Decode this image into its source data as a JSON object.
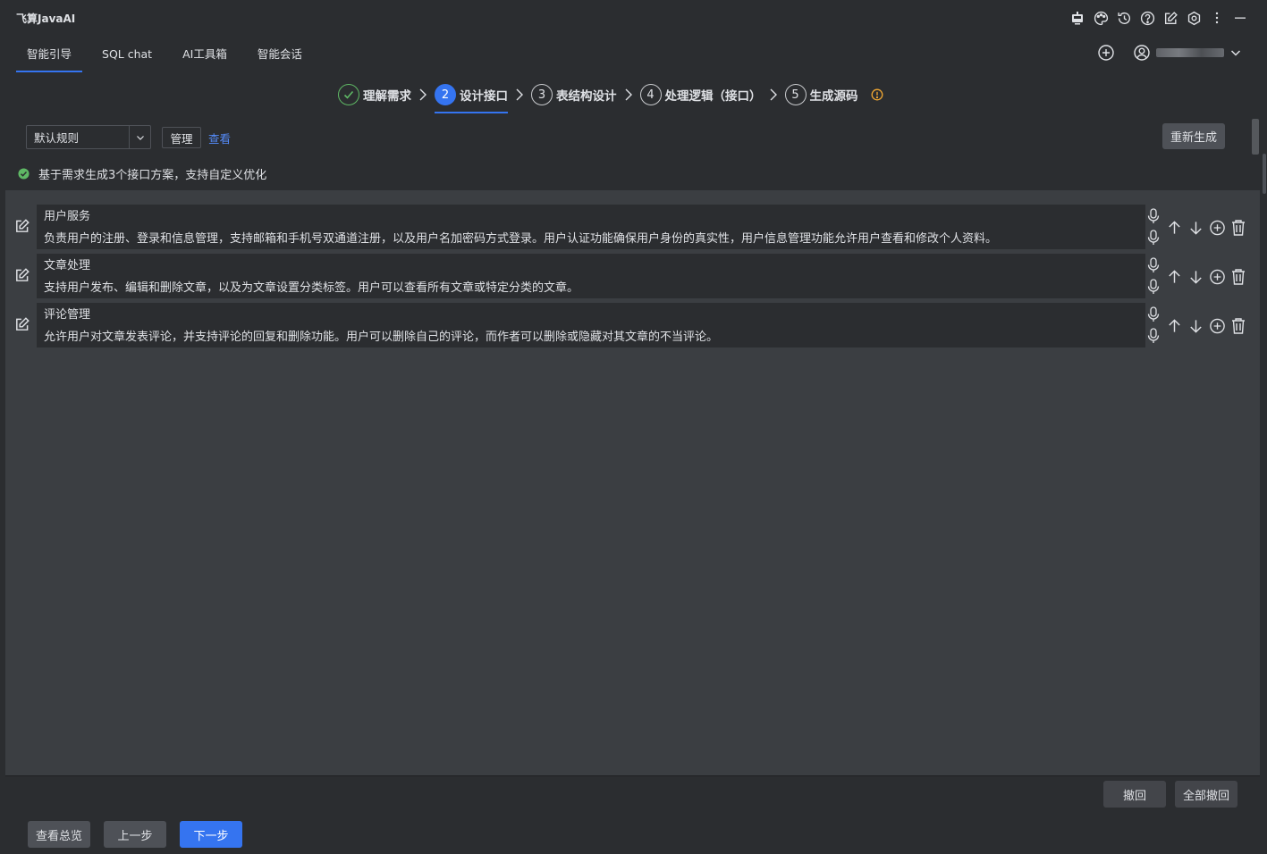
{
  "app": {
    "title": "飞算JavaAI"
  },
  "titlebar_icons": [
    "robot-icon",
    "palette-icon",
    "history-icon",
    "help-icon",
    "edit-icon",
    "settings-icon",
    "more-vertical-icon",
    "minimize-icon"
  ],
  "tabs": [
    {
      "label": "智能引导",
      "active": true
    },
    {
      "label": "SQL chat",
      "active": false
    },
    {
      "label": "AI工具箱",
      "active": false
    },
    {
      "label": "智能会话",
      "active": false
    }
  ],
  "steps": [
    {
      "num": "✓",
      "label": "理解需求",
      "state": "done"
    },
    {
      "num": "2",
      "label": "设计接口",
      "state": "active"
    },
    {
      "num": "3",
      "label": "表结构设计",
      "state": "pending"
    },
    {
      "num": "4",
      "label": "处理逻辑（接口）",
      "state": "pending"
    },
    {
      "num": "5",
      "label": "生成源码",
      "state": "pending"
    }
  ],
  "toolbar": {
    "rule_select": "默认规则",
    "manage_label": "管理",
    "view_label": "查看",
    "regenerate_label": "重新生成"
  },
  "info": {
    "text": "基于需求生成3个接口方案，支持自定义优化"
  },
  "items": [
    {
      "title": "用户服务",
      "desc": "负责用户的注册、登录和信息管理，支持邮箱和手机号双通道注册，以及用户名加密码方式登录。用户认证功能确保用户身份的真实性，用户信息管理功能允许用户查看和修改个人资料。"
    },
    {
      "title": "文章处理",
      "desc": "支持用户发布、编辑和删除文章，以及为文章设置分类标签。用户可以查看所有文章或特定分类的文章。"
    },
    {
      "title": "评论管理",
      "desc": "允许用户对文章发表评论，并支持评论的回复和删除功能。用户可以删除自己的评论，而作者可以删除或隐藏对其文章的不当评论。"
    }
  ],
  "undo": {
    "undo_label": "撤回",
    "undo_all_label": "全部撤回"
  },
  "footer": {
    "overview_label": "查看总览",
    "prev_label": "上一步",
    "next_label": "下一步"
  },
  "colors": {
    "accent": "#3574f0",
    "success": "#5fb865",
    "warning": "#f0a732",
    "link": "#548af7"
  }
}
